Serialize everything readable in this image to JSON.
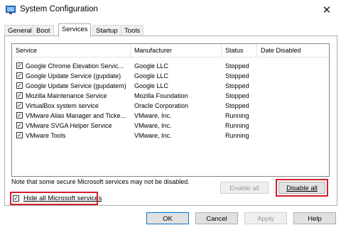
{
  "window": {
    "title": "System Configuration",
    "icon": "system-config-icon"
  },
  "tabs": [
    {
      "label": "General"
    },
    {
      "label": "Boot"
    },
    {
      "label": "Services",
      "active": true
    },
    {
      "label": "Startup"
    },
    {
      "label": "Tools"
    }
  ],
  "columns": {
    "service": "Service",
    "manufacturer": "Manufacturer",
    "status": "Status",
    "date_disabled": "Date Disabled"
  },
  "services": [
    {
      "checked": true,
      "service": "Google Chrome Elevation Servic...",
      "manufacturer": "Google LLC",
      "status": "Stopped",
      "date_disabled": ""
    },
    {
      "checked": true,
      "service": "Google Update Service (gupdate)",
      "manufacturer": "Google LLC",
      "status": "Stopped",
      "date_disabled": ""
    },
    {
      "checked": true,
      "service": "Google Update Service (gupdatem)",
      "manufacturer": "Google LLC",
      "status": "Stopped",
      "date_disabled": ""
    },
    {
      "checked": true,
      "service": "Mozilla Maintenance Service",
      "manufacturer": "Mozilla Foundation",
      "status": "Stopped",
      "date_disabled": ""
    },
    {
      "checked": true,
      "service": "VirtualBox system service",
      "manufacturer": "Oracle Corporation",
      "status": "Stopped",
      "date_disabled": ""
    },
    {
      "checked": true,
      "service": "VMware Alias Manager and Ticke...",
      "manufacturer": "VMware, Inc.",
      "status": "Running",
      "date_disabled": ""
    },
    {
      "checked": true,
      "service": "VMware SVGA Helper Service",
      "manufacturer": "VMware, Inc.",
      "status": "Running",
      "date_disabled": ""
    },
    {
      "checked": true,
      "service": "VMware Tools",
      "manufacturer": "VMware, Inc.",
      "status": "Running",
      "date_disabled": ""
    }
  ],
  "note": "Note that some secure Microsoft services may not be disabled.",
  "buttons": {
    "enable_all": "Enable all",
    "disable_all": "Disable all",
    "ok": "OK",
    "cancel": "Cancel",
    "apply": "Apply",
    "help": "Help"
  },
  "hide_ms": {
    "label": "Hide all Microsoft services",
    "checked": true
  },
  "highlight_color": "#d0202e"
}
